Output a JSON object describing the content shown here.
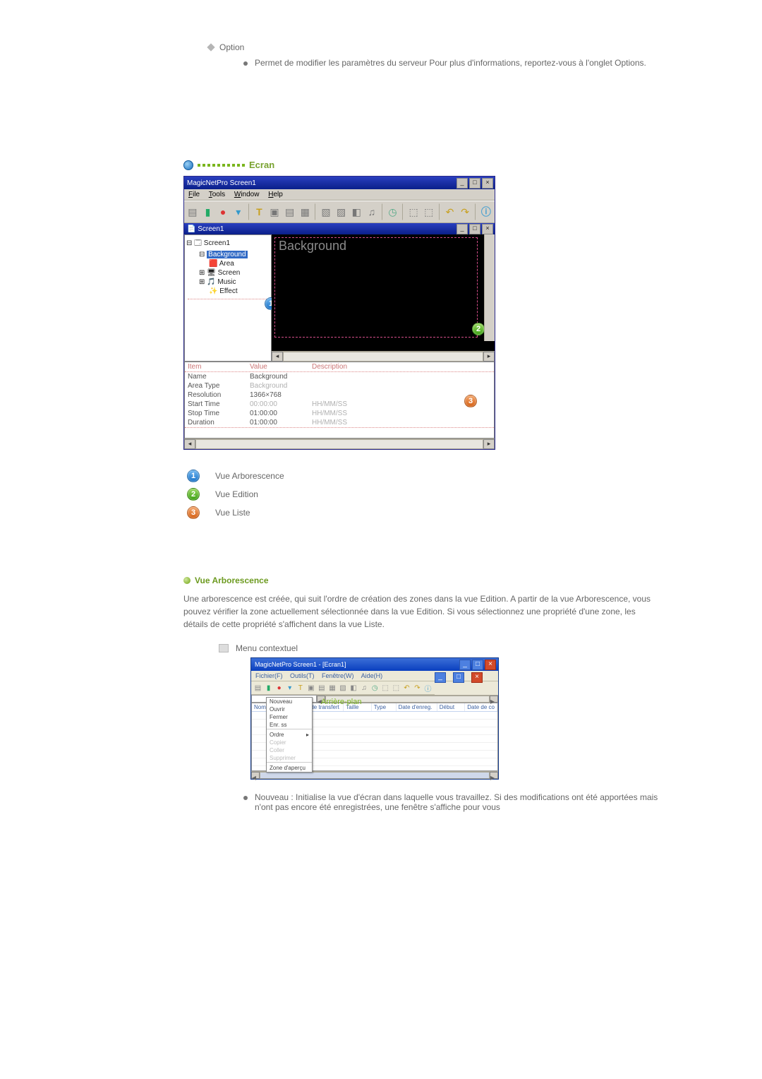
{
  "option": {
    "label": "Option",
    "desc": "Permet de modifier les paramètres du serveur Pour plus d'informations, reportez-vous à l'onglet Options."
  },
  "section_ecran": {
    "title": "Ecran"
  },
  "app1": {
    "title": "MagicNetPro Screen1",
    "menu": {
      "file": "File",
      "tools": "Tools",
      "window": "Window",
      "help": "Help"
    },
    "sub_title": "Screen1",
    "tree": {
      "root": "Screen1",
      "items": [
        "Background",
        "Area",
        "Screen",
        "Music",
        "Effect"
      ]
    },
    "canvas_label": "Background",
    "list": {
      "headers": {
        "item": "Item",
        "value": "Value",
        "desc": "Description"
      },
      "rows": [
        {
          "item": "Name",
          "value": "Background",
          "desc": ""
        },
        {
          "item": "Area Type",
          "value": "Background",
          "desc": ""
        },
        {
          "item": "Resolution",
          "value": "1366×768",
          "desc": ""
        },
        {
          "item": "Start Time",
          "value": "00:00:00",
          "desc": "HH/MM/SS"
        },
        {
          "item": "Stop Time",
          "value": "01:00:00",
          "desc": "HH/MM/SS"
        },
        {
          "item": "Duration",
          "value": "01:00:00",
          "desc": "HH/MM/SS"
        }
      ]
    }
  },
  "legend": {
    "one": "Vue Arborescence",
    "two": "Vue Edition",
    "three": "Vue Liste"
  },
  "section_arbo": {
    "title": "Vue Arborescence",
    "text": "Une arborescence est créée, qui suit l'ordre de création des zones dans la vue Edition. A partir de la vue Arborescence, vous pouvez vérifier la zone actuellement sélectionnée dans la vue Edition. Si vous sélectionnez une propriété d'une zone, les détails de cette propriété s'affichent dans la vue Liste.",
    "context_label": "Menu contextuel"
  },
  "app2": {
    "title": "MagicNetPro Screen1 - [Ecran1]",
    "menu": {
      "fichier": "Fichier(F)",
      "outils": "Outils(T)",
      "fenetre": "Fenêtre(W)",
      "aide": "Aide(H)"
    },
    "ctx": {
      "nouveau": "Nouveau",
      "ouvrir": "Ouvrir",
      "fermer": "Fermer",
      "enrsous": "Enr. ss",
      "ordre": "Ordre",
      "copier": "Copier",
      "coller": "Coller",
      "supprimer": "Supprimer",
      "zone": "Zone d'aperçu"
    },
    "canvas_label": "Arrière-plan",
    "grid_headers": {
      "nom": "Nom",
      "mode": "Mode de transfert",
      "taille": "Taille",
      "type": "Type",
      "date": "Date d'enreg.",
      "debut": "Début",
      "datec": "Date de co"
    }
  },
  "bottom": {
    "nouveau": "Nouveau : Initialise la vue d'écran dans laquelle vous travaillez. Si des modifications ont été apportées mais n'ont pas encore été enregistrées, une fenêtre s'affiche pour vous"
  }
}
